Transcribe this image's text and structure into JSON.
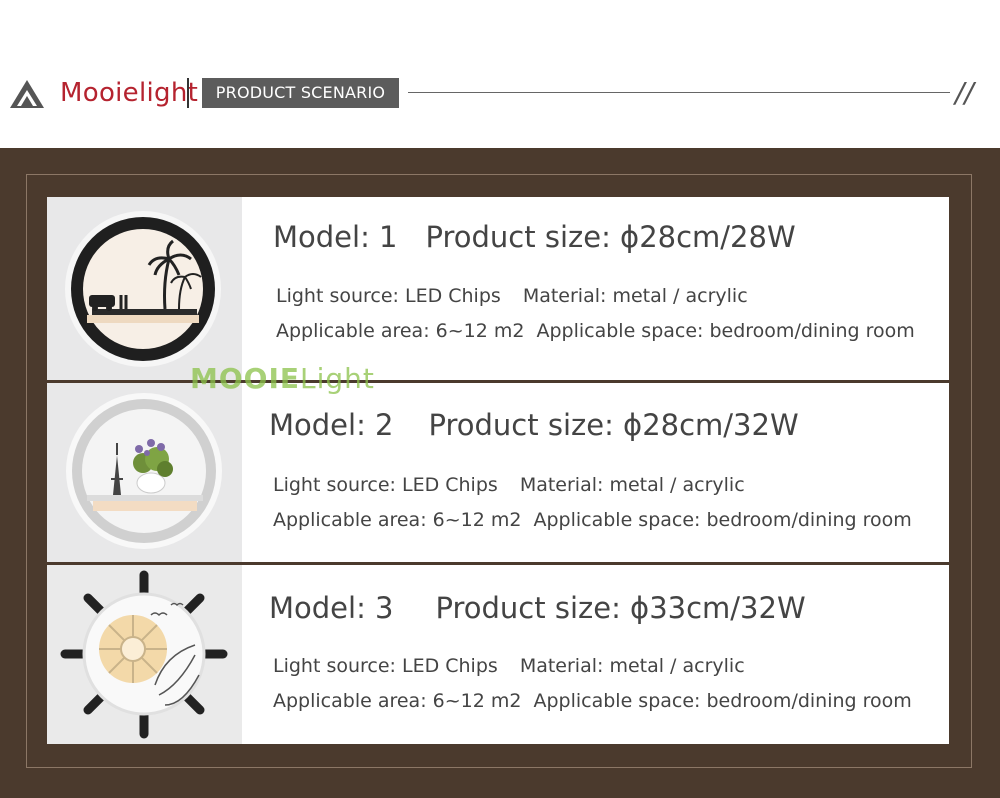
{
  "header": {
    "brand": "Mooielight",
    "scenario_tag": "PRODUCT SCENARIO",
    "slashes": "//",
    "brand_color": "#b5232f"
  },
  "watermark": {
    "text_bold": "MOOIE",
    "text_light": "Light"
  },
  "models": [
    {
      "model": "Model: 1",
      "size": "Product size: ϕ28cm/28W",
      "light_source": "Light source: LED Chips",
      "material": "Material: metal / acrylic",
      "area": "Applicable area: 6~12 m2",
      "space": "Applicable space: bedroom/dining room",
      "image": "round-wall-lamp-palm-beach-car"
    },
    {
      "model": "Model: 2",
      "size": "Product size: ϕ28cm/32W",
      "light_source": "Light source: LED Chips",
      "material": "Material: metal / acrylic",
      "area": "Applicable area: 6~12 m2",
      "space": "Applicable space: bedroom/dining room",
      "image": "round-wall-lamp-eiffel-tower-flower-pot"
    },
    {
      "model": "Model: 3",
      "size": "Product size: ϕ33cm/32W",
      "light_source": "Light source: LED Chips",
      "material": "Material: metal / acrylic",
      "area": "Applicable area: 6~12 m2",
      "space": "Applicable space: bedroom/dining room",
      "image": "ship-wheel-wall-lamp"
    }
  ]
}
